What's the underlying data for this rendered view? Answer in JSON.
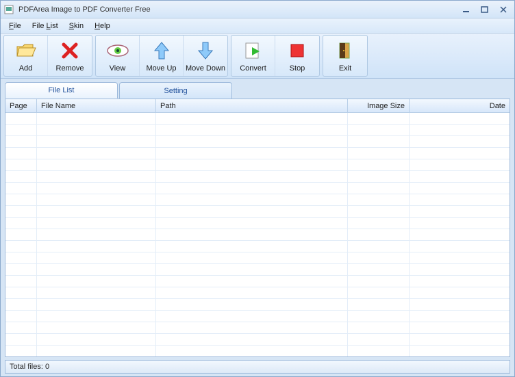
{
  "window": {
    "title": "PDFArea Image to PDF Converter Free"
  },
  "menu": {
    "file": "File",
    "filelist": "File List",
    "skin": "Skin",
    "help": "Help"
  },
  "toolbar": {
    "add": "Add",
    "remove": "Remove",
    "view": "View",
    "moveup": "Move Up",
    "movedown": "Move Down",
    "convert": "Convert",
    "stop": "Stop",
    "exit": "Exit"
  },
  "tabs": {
    "filelist": "File List",
    "setting": "Setting",
    "active": "filelist"
  },
  "columns": {
    "page": "Page",
    "name": "File Name",
    "path": "Path",
    "size": "Image Size",
    "date": "Date"
  },
  "rows": [],
  "status": {
    "text": "Total files: 0"
  }
}
